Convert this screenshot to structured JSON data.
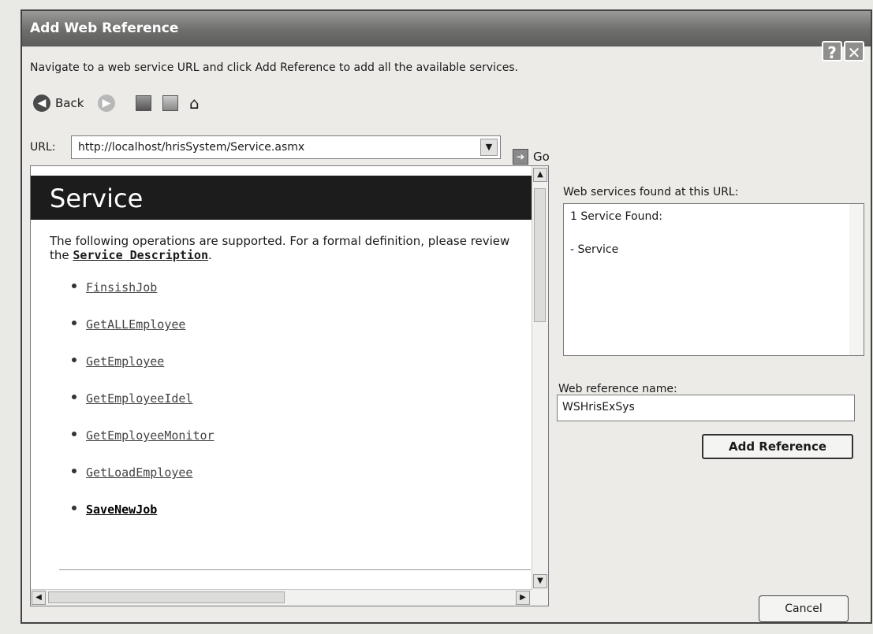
{
  "window": {
    "title": "Add Web Reference",
    "help_label": "?",
    "close_label": "✕"
  },
  "instruction": "Navigate to a web service URL and click Add Reference to add all the available services.",
  "toolbar": {
    "back_label": "Back",
    "icons": [
      "back-icon",
      "forward-icon",
      "stop-icon",
      "refresh-icon",
      "home-icon"
    ]
  },
  "url_bar": {
    "label": "URL:",
    "value": "http://localhost/hrisSystem/Service.asmx",
    "go_label": "Go"
  },
  "service_page": {
    "title": "Service",
    "description_prefix": "The following operations are supported. For a formal definition, please review the ",
    "description_link": "Service Description",
    "description_suffix": ".",
    "operations": [
      "FinsishJob",
      "GetALLEmployee",
      "GetEmployee",
      "GetEmployeeIdel",
      "GetEmployeeMonitor",
      "GetLoadEmployee",
      "SaveNewJob"
    ]
  },
  "found_panel": {
    "label": "Web services found at this URL:",
    "count_text": "1 Service Found:",
    "items": [
      "- Service"
    ]
  },
  "reference": {
    "name_label": "Web reference name:",
    "name_value": "WSHrisExSys",
    "add_button": "Add Reference"
  },
  "cancel_button": "Cancel"
}
